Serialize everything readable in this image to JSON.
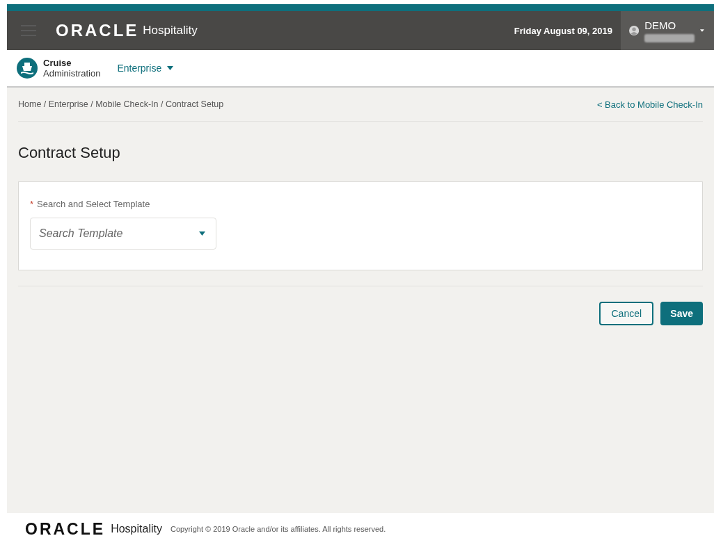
{
  "header": {
    "logo": "ORACLE",
    "product": "Hospitality",
    "date": "Friday August 09, 2019",
    "user": "DEMO"
  },
  "subheader": {
    "app_line1": "Cruise",
    "app_line2": "Administration",
    "menu": "Enterprise"
  },
  "breadcrumb": "Home / Enterprise / Mobile Check-In / Contract Setup",
  "back_link": "< Back to Mobile Check-In",
  "page_title": "Contract Setup",
  "form": {
    "required_mark": "*",
    "label": "Search and Select Template",
    "placeholder": "Search Template"
  },
  "buttons": [
    {
      "label": "Cancel",
      "kind": "secondary"
    },
    {
      "label": "Save",
      "kind": "primary"
    }
  ],
  "footer": {
    "logo": "ORACLE",
    "product": "Hospitality",
    "copyright": "Copyright © 2019 Oracle and/or its affiliates. All rights reserved."
  }
}
